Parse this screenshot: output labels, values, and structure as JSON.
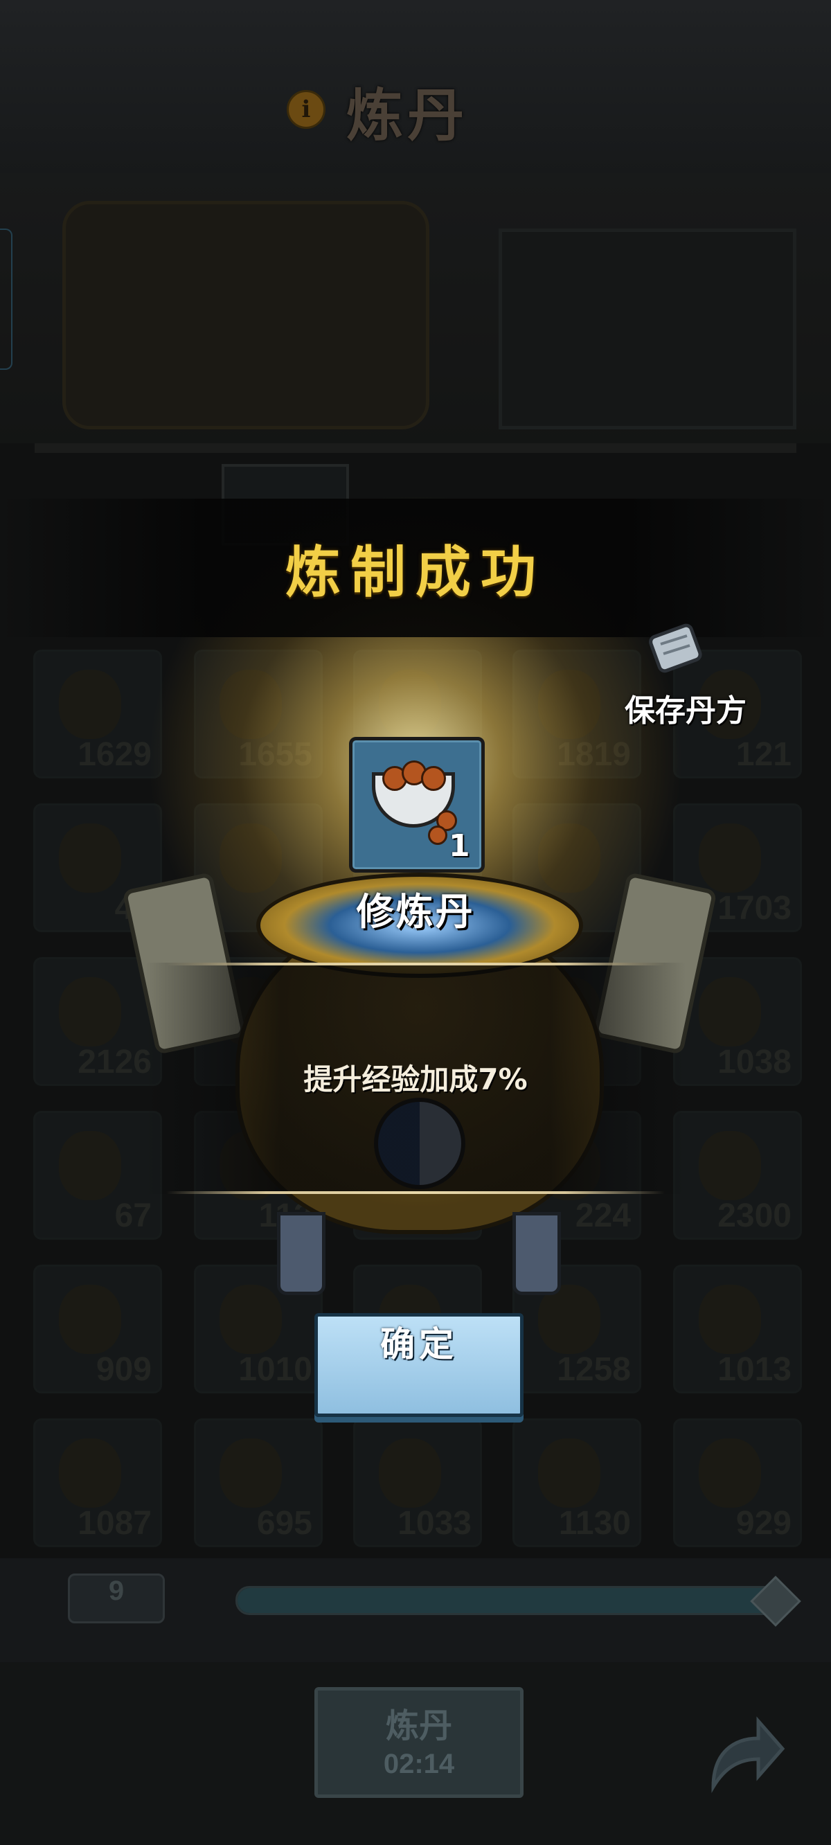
{
  "header": {
    "title": "炼丹",
    "info_icon": "info-icon"
  },
  "inventory": {
    "rows": [
      [
        "1629",
        "1655",
        "",
        "1819",
        "121"
      ],
      [
        "45",
        "",
        "",
        "",
        "1703"
      ],
      [
        "2126",
        "",
        "",
        "",
        "1038"
      ],
      [
        "67",
        "113",
        "",
        "224",
        "2300"
      ],
      [
        "909",
        "1010",
        "",
        "1258",
        "1013"
      ],
      [
        "1087",
        "695",
        "1033",
        "1130",
        "929"
      ]
    ]
  },
  "result": {
    "title": "炼制成功",
    "item_name": "修炼丹",
    "item_quantity": "1",
    "item_icon": "pill-bowl-icon",
    "effect": "提升经验加成7%",
    "save_recipe_label": "保存丹方",
    "save_recipe_icon": "scroll-icon"
  },
  "confirm_label": "确定",
  "controls": {
    "quantity": "9",
    "slider_level": 1.0,
    "refine_label": "炼丹",
    "refine_timer": "02:14",
    "share_icon": "share-arrow-icon"
  },
  "colors": {
    "title_gold": "#f2cf47",
    "confirm_blue": "#9fcbe8",
    "tile_blue": "#3d6f90"
  }
}
